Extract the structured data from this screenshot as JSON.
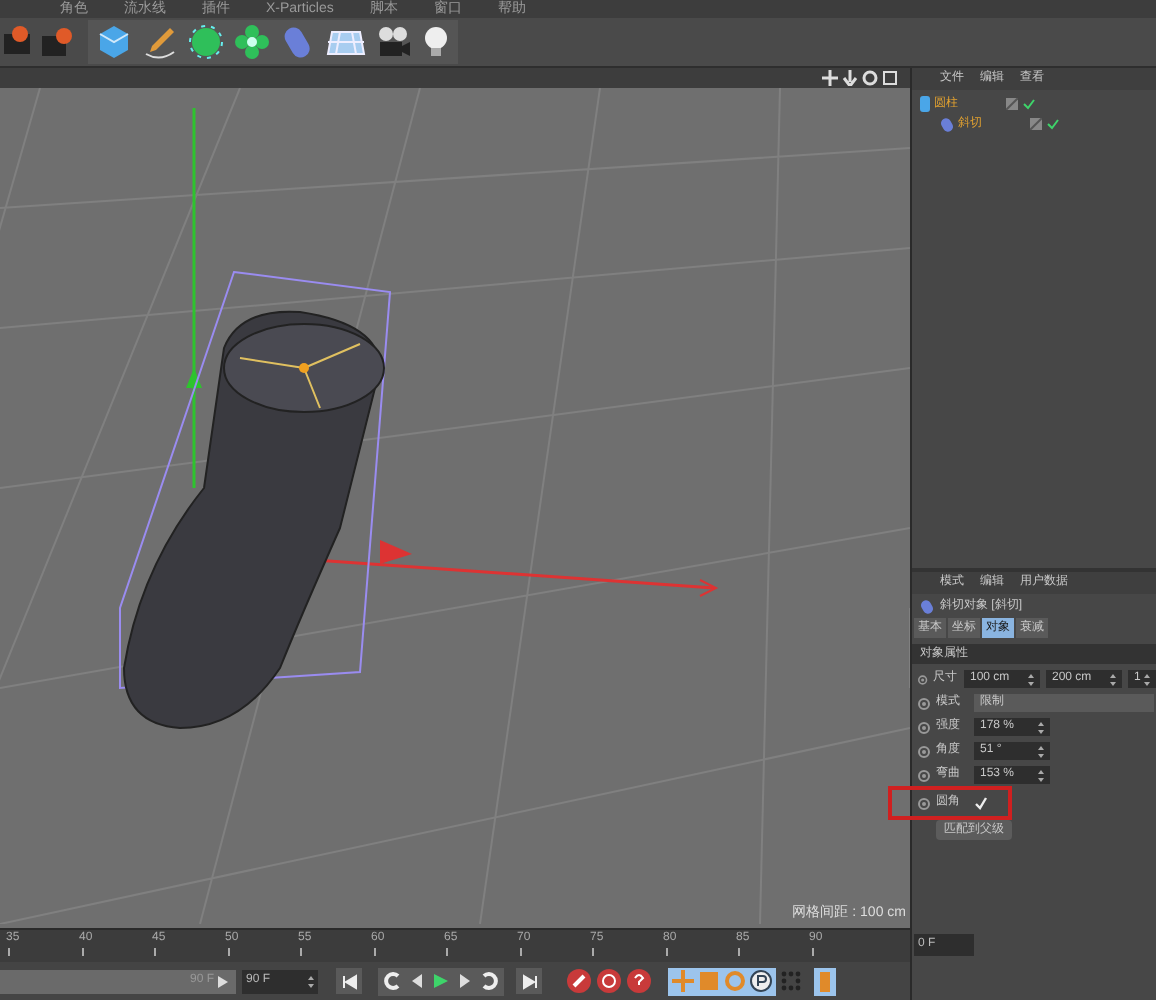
{
  "menu": [
    "角色",
    "流水线",
    "插件",
    "X-Particles",
    "脚本",
    "窗口",
    "帮助"
  ],
  "viewport": {
    "grid_spacing": "网格间距 : 100 cm"
  },
  "object_manager": {
    "tabs": [
      "文件",
      "编辑",
      "查看"
    ],
    "objects": [
      {
        "name": "圆柱",
        "children": [
          {
            "name": "斜切"
          }
        ]
      }
    ]
  },
  "attributes": {
    "menu": [
      "模式",
      "编辑",
      "用户数据"
    ],
    "title": "斜切对象 [斜切]",
    "tabs": [
      {
        "label": "基本",
        "selected": false
      },
      {
        "label": "坐标",
        "selected": false
      },
      {
        "label": "对象",
        "selected": true
      },
      {
        "label": "衰减",
        "selected": false
      }
    ],
    "section": "对象属性",
    "rows": [
      {
        "kind": "multi",
        "label": "尺寸",
        "values": [
          "100 cm",
          "200 cm",
          "1"
        ]
      },
      {
        "kind": "dropdown",
        "label": "模式",
        "value": "限制"
      },
      {
        "kind": "number",
        "label": "强度",
        "value": "178 %"
      },
      {
        "kind": "number",
        "label": "角度",
        "value": "51 °"
      },
      {
        "kind": "number",
        "label": "弯曲",
        "value": "153 %"
      },
      {
        "kind": "checkbox",
        "label": "圆角",
        "checked": true
      }
    ],
    "button": "匹配到父级"
  },
  "timeline": {
    "level": 1,
    "ticks": [
      "35",
      "40",
      "45",
      "50",
      "55",
      "60",
      "65",
      "70",
      "75",
      "80",
      "85",
      "90"
    ],
    "end_frame": "90 F",
    "max_field": "90 F",
    "current_frame": "0 F"
  }
}
